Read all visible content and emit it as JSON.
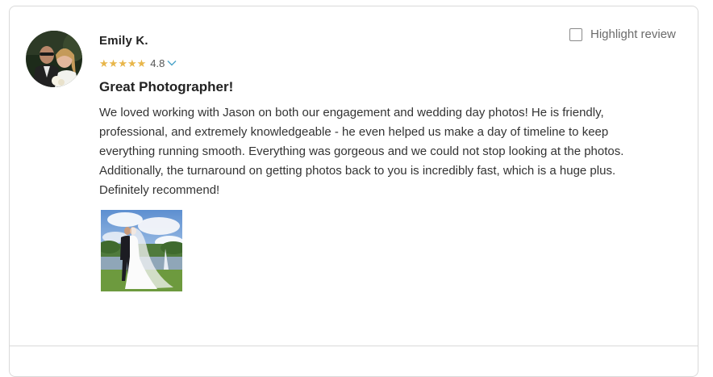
{
  "review": {
    "reviewer_name": "Emily K.",
    "rating_value": "4.8",
    "stars": [
      "★",
      "★",
      "★",
      "★",
      "★"
    ],
    "title": "Great Photographer!",
    "body": "We loved working with Jason on both our engagement and wedding day photos! He is friendly,\nprofessional, and extremely knowledgeable - he even helped us make a day of timeline to keep\neverything running smooth. Everything was gorgeous and we could not stop looking at the photos.\nAdditionally, the turnaround on getting photos back to you is incredibly fast, which is a huge plus.\nDefinitely recommend!",
    "highlight_label": "Highlight review",
    "highlight_checked": false,
    "icons": {
      "star": "star-icon",
      "chevron": "chevron-down-icon",
      "checkbox": "checkbox-icon"
    },
    "colors": {
      "star": "#e8b64a",
      "chevron": "#4aa3c8",
      "border": "#d9d9d9"
    }
  }
}
